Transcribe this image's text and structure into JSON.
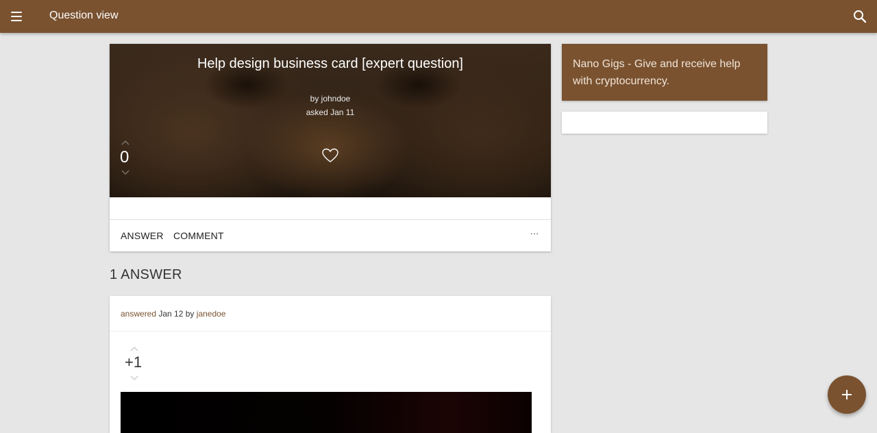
{
  "colors": {
    "brand": "#7a5230",
    "background": "#e6e6e6",
    "card": "#ffffff",
    "accent_text": "#7a5230"
  },
  "appbar": {
    "title": "Question view",
    "menu_icon": "menu-icon",
    "search_icon": "search-icon"
  },
  "question": {
    "title": "Help design business card [expert question]",
    "author_line": "by johndoe",
    "asked_line": "asked Jan 11",
    "score": "0",
    "favorite_icon": "heart-outline-icon",
    "actions": {
      "answer": "ANSWER",
      "comment": "COMMENT",
      "more": "···"
    }
  },
  "answers": {
    "heading": "1 ANSWER",
    "items": [
      {
        "answered_label": "answered",
        "date": "Jan 12",
        "by": "by",
        "author": "janedoe",
        "score": "+1"
      }
    ]
  },
  "sidebar": {
    "promo_text": "Nano Gigs - Give and receive help with cryptocurrency."
  },
  "fab": {
    "icon": "plus-icon"
  }
}
